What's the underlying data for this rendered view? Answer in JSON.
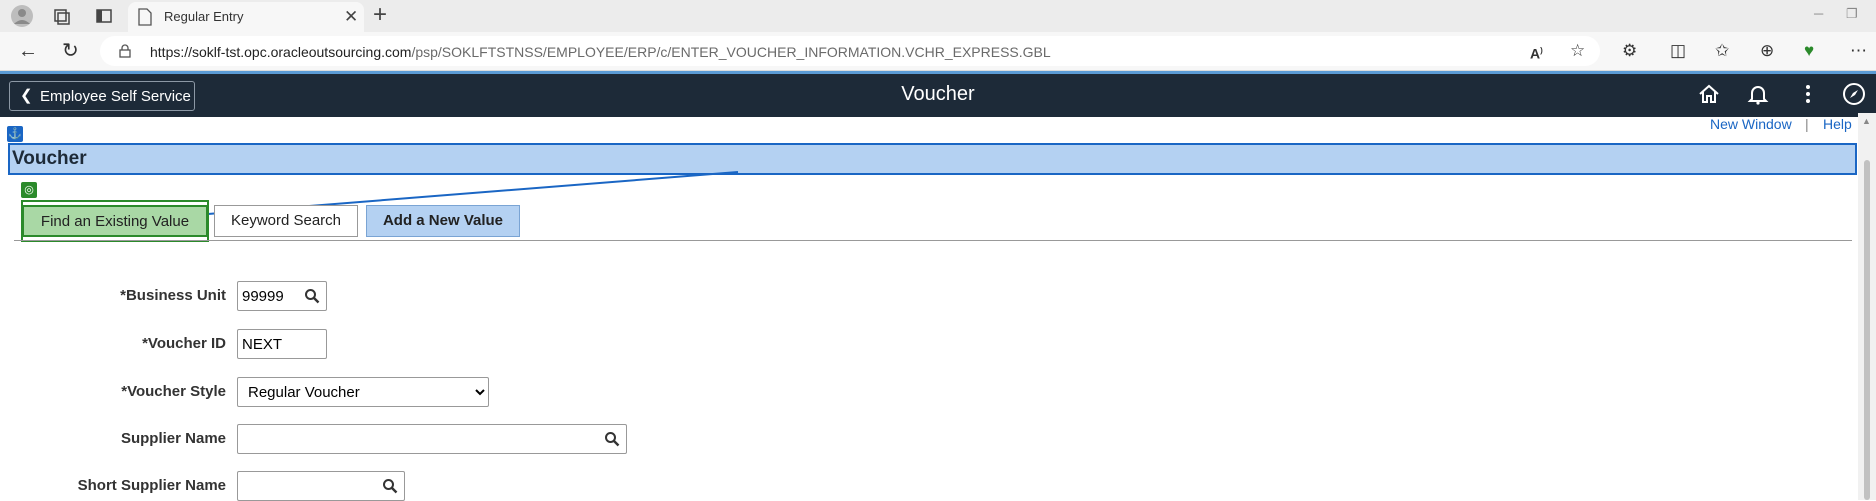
{
  "browser": {
    "tab_title": "Regular Entry",
    "new_tab_symbol": "+",
    "url_host": "https://soklf-tst.opc.oracleoutsourcing.com",
    "url_path": "/psp/SOKLFTSTNSS/EMPLOYEE/ERP/c/ENTER_VOUCHER_INFORMATION.VCHR_EXPRESS.GBL"
  },
  "banner": {
    "back_label": "Employee Self Service",
    "title": "Voucher"
  },
  "page": {
    "new_window_link": "New Window",
    "separator": "|",
    "help_link": "Help",
    "heading": "Voucher"
  },
  "tabs": {
    "find_existing": "Find an Existing Value",
    "keyword_search": "Keyword Search",
    "add_new": "Add a New Value"
  },
  "form": {
    "business_unit": {
      "label": "*Business Unit",
      "value": "99999"
    },
    "voucher_id": {
      "label": "*Voucher ID",
      "value": "NEXT"
    },
    "voucher_style": {
      "label": "*Voucher Style",
      "value": "Regular Voucher"
    },
    "supplier_name": {
      "label": "Supplier Name",
      "value": ""
    },
    "short_supplier_name": {
      "label": "Short Supplier Name",
      "value": ""
    }
  },
  "colors": {
    "banner_bg": "#1d2a38",
    "header_bg": "#b4d1f2",
    "accent_blue": "#1a66c4",
    "focus_green": "#2b8a2b"
  }
}
